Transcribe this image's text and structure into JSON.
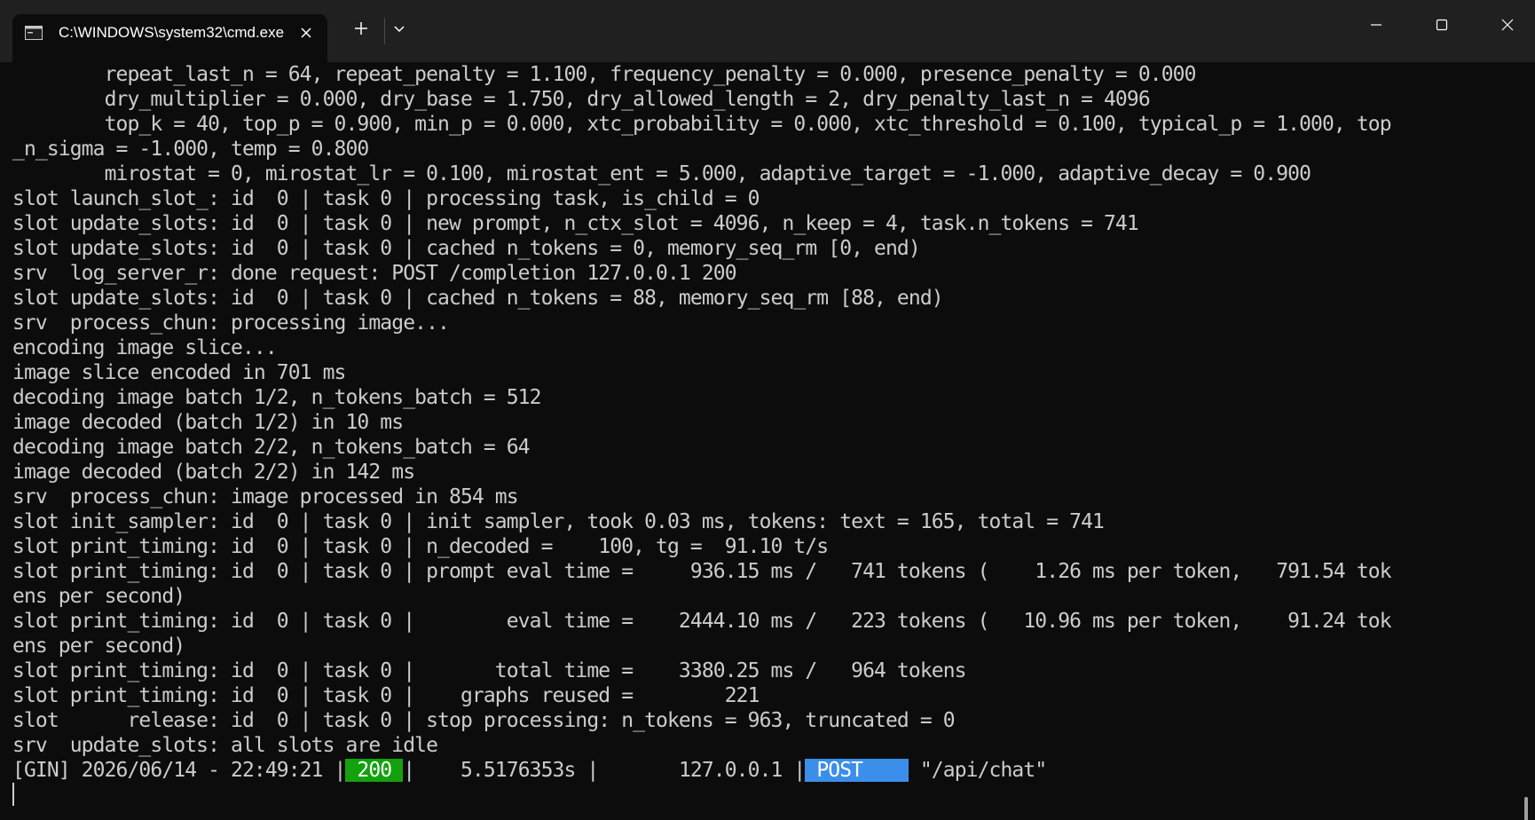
{
  "window": {
    "tab_title": "C:\\WINDOWS\\system32\\cmd.exe"
  },
  "icons": {
    "tab": "terminal-icon",
    "tab_close": "close-icon",
    "new_tab": "plus-icon",
    "dropdown": "chevron-down-icon",
    "minimize": "minimize-icon",
    "maximize": "maximize-icon",
    "close": "close-icon"
  },
  "colors": {
    "background": "#0c0c0c",
    "text": "#cccccc",
    "status_badge": "#13a10e",
    "method_badge": "#3b8eea"
  },
  "terminal": {
    "lines": [
      "        repeat_last_n = 64, repeat_penalty = 1.100, frequency_penalty = 0.000, presence_penalty = 0.000",
      "        dry_multiplier = 0.000, dry_base = 1.750, dry_allowed_length = 2, dry_penalty_last_n = 4096",
      "        top_k = 40, top_p = 0.900, min_p = 0.000, xtc_probability = 0.000, xtc_threshold = 0.100, typical_p = 1.000, top",
      "_n_sigma = -1.000, temp = 0.800",
      "        mirostat = 0, mirostat_lr = 0.100, mirostat_ent = 5.000, adaptive_target = -1.000, adaptive_decay = 0.900",
      "slot launch_slot_: id  0 | task 0 | processing task, is_child = 0",
      "slot update_slots: id  0 | task 0 | new prompt, n_ctx_slot = 4096, n_keep = 4, task.n_tokens = 741",
      "slot update_slots: id  0 | task 0 | cached n_tokens = 0, memory_seq_rm [0, end)",
      "srv  log_server_r: done request: POST /completion 127.0.0.1 200",
      "slot update_slots: id  0 | task 0 | cached n_tokens = 88, memory_seq_rm [88, end)",
      "srv  process_chun: processing image...",
      "encoding image slice...",
      "image slice encoded in 701 ms",
      "decoding image batch 1/2, n_tokens_batch = 512",
      "image decoded (batch 1/2) in 10 ms",
      "decoding image batch 2/2, n_tokens_batch = 64",
      "image decoded (batch 2/2) in 142 ms",
      "srv  process_chun: image processed in 854 ms",
      "slot init_sampler: id  0 | task 0 | init sampler, took 0.03 ms, tokens: text = 165, total = 741",
      "slot print_timing: id  0 | task 0 | n_decoded =    100, tg =  91.10 t/s",
      "slot print_timing: id  0 | task 0 | prompt eval time =     936.15 ms /   741 tokens (    1.26 ms per token,   791.54 tok",
      "ens per second)",
      "slot print_timing: id  0 | task 0 |        eval time =    2444.10 ms /   223 tokens (   10.96 ms per token,    91.24 tok",
      "ens per second)",
      "slot print_timing: id  0 | task 0 |       total time =    3380.25 ms /   964 tokens",
      "slot print_timing: id  0 | task 0 |    graphs reused =        221",
      "slot      release: id  0 | task 0 | stop processing: n_tokens = 963, truncated = 0",
      "srv  update_slots: all slots are idle"
    ],
    "gin_line": {
      "prefix": "[GIN] 2026/06/14 - 22:49:21 |",
      "status": " 200 ",
      "middle": "|    5.5176353s |       127.0.0.1 |",
      "method": " POST    ",
      "path": " \"/api/chat\""
    }
  }
}
